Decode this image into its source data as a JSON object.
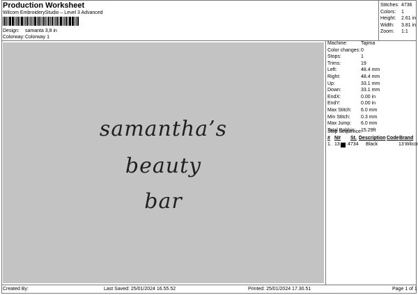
{
  "header": {
    "title": "Production Worksheet",
    "subtitle": "Wilcom EmbroideryStudio – Level 3 Advanced",
    "design_label": "Design:",
    "design_value": "samanta 3,8 in",
    "colorway_label": "Colorway:",
    "colorway_value": "Colorway 1"
  },
  "stats": [
    {
      "label": "Stitches:",
      "value": "4736"
    },
    {
      "label": "Colors:",
      "value": "1"
    },
    {
      "label": "Height:",
      "value": "2.61 in"
    },
    {
      "label": "Width:",
      "value": "3.81 in"
    },
    {
      "label": "Zoom:",
      "value": "1:1"
    }
  ],
  "design_text": [
    "samantha’s",
    "beauty",
    "bar"
  ],
  "design_colors": {
    "canvas": "#c3c3c3",
    "thread": "#202020"
  },
  "info": [
    {
      "label": "Machine:",
      "value": "Tajima"
    },
    {
      "label": "Color changes:",
      "value": "0"
    },
    {
      "label": "Stops:",
      "value": "1"
    },
    {
      "label": "Trims:",
      "value": "19"
    },
    {
      "label": "Left:",
      "value": "48.4 mm"
    },
    {
      "label": "Right:",
      "value": "48.4 mm"
    },
    {
      "label": "Up:",
      "value": "33.1 mm"
    },
    {
      "label": "Down:",
      "value": "33.1 mm"
    },
    {
      "label": "EndX:",
      "value": "0.00 in"
    },
    {
      "label": "EndY:",
      "value": "0.00 in"
    },
    {
      "label": "Max Stitch:",
      "value": "6.0 mm"
    },
    {
      "label": "Min Stitch:",
      "value": "0.3 mm"
    },
    {
      "label": "Max Jump:",
      "value": "6.0 mm"
    },
    {
      "label": "Total Bobbin:",
      "value": "15.29ft"
    }
  ],
  "stop_sequence": {
    "title": "Stop Sequence:",
    "headers": [
      "#",
      "N#",
      "St.",
      "Description",
      "Code",
      "Brand"
    ],
    "rows": [
      {
        "num": "1.",
        "n": "13",
        "swatch": "#000000",
        "stitches": "4734",
        "description": "Black",
        "code": "13",
        "brand": "Wilcom"
      }
    ]
  },
  "footer": {
    "created_by": "Created By:",
    "last_saved": "Last Saved: 25/01/2024 16.55.52",
    "printed": "Printed: 25/01/2024 17.30.51",
    "page": "Page 1 of 1"
  }
}
